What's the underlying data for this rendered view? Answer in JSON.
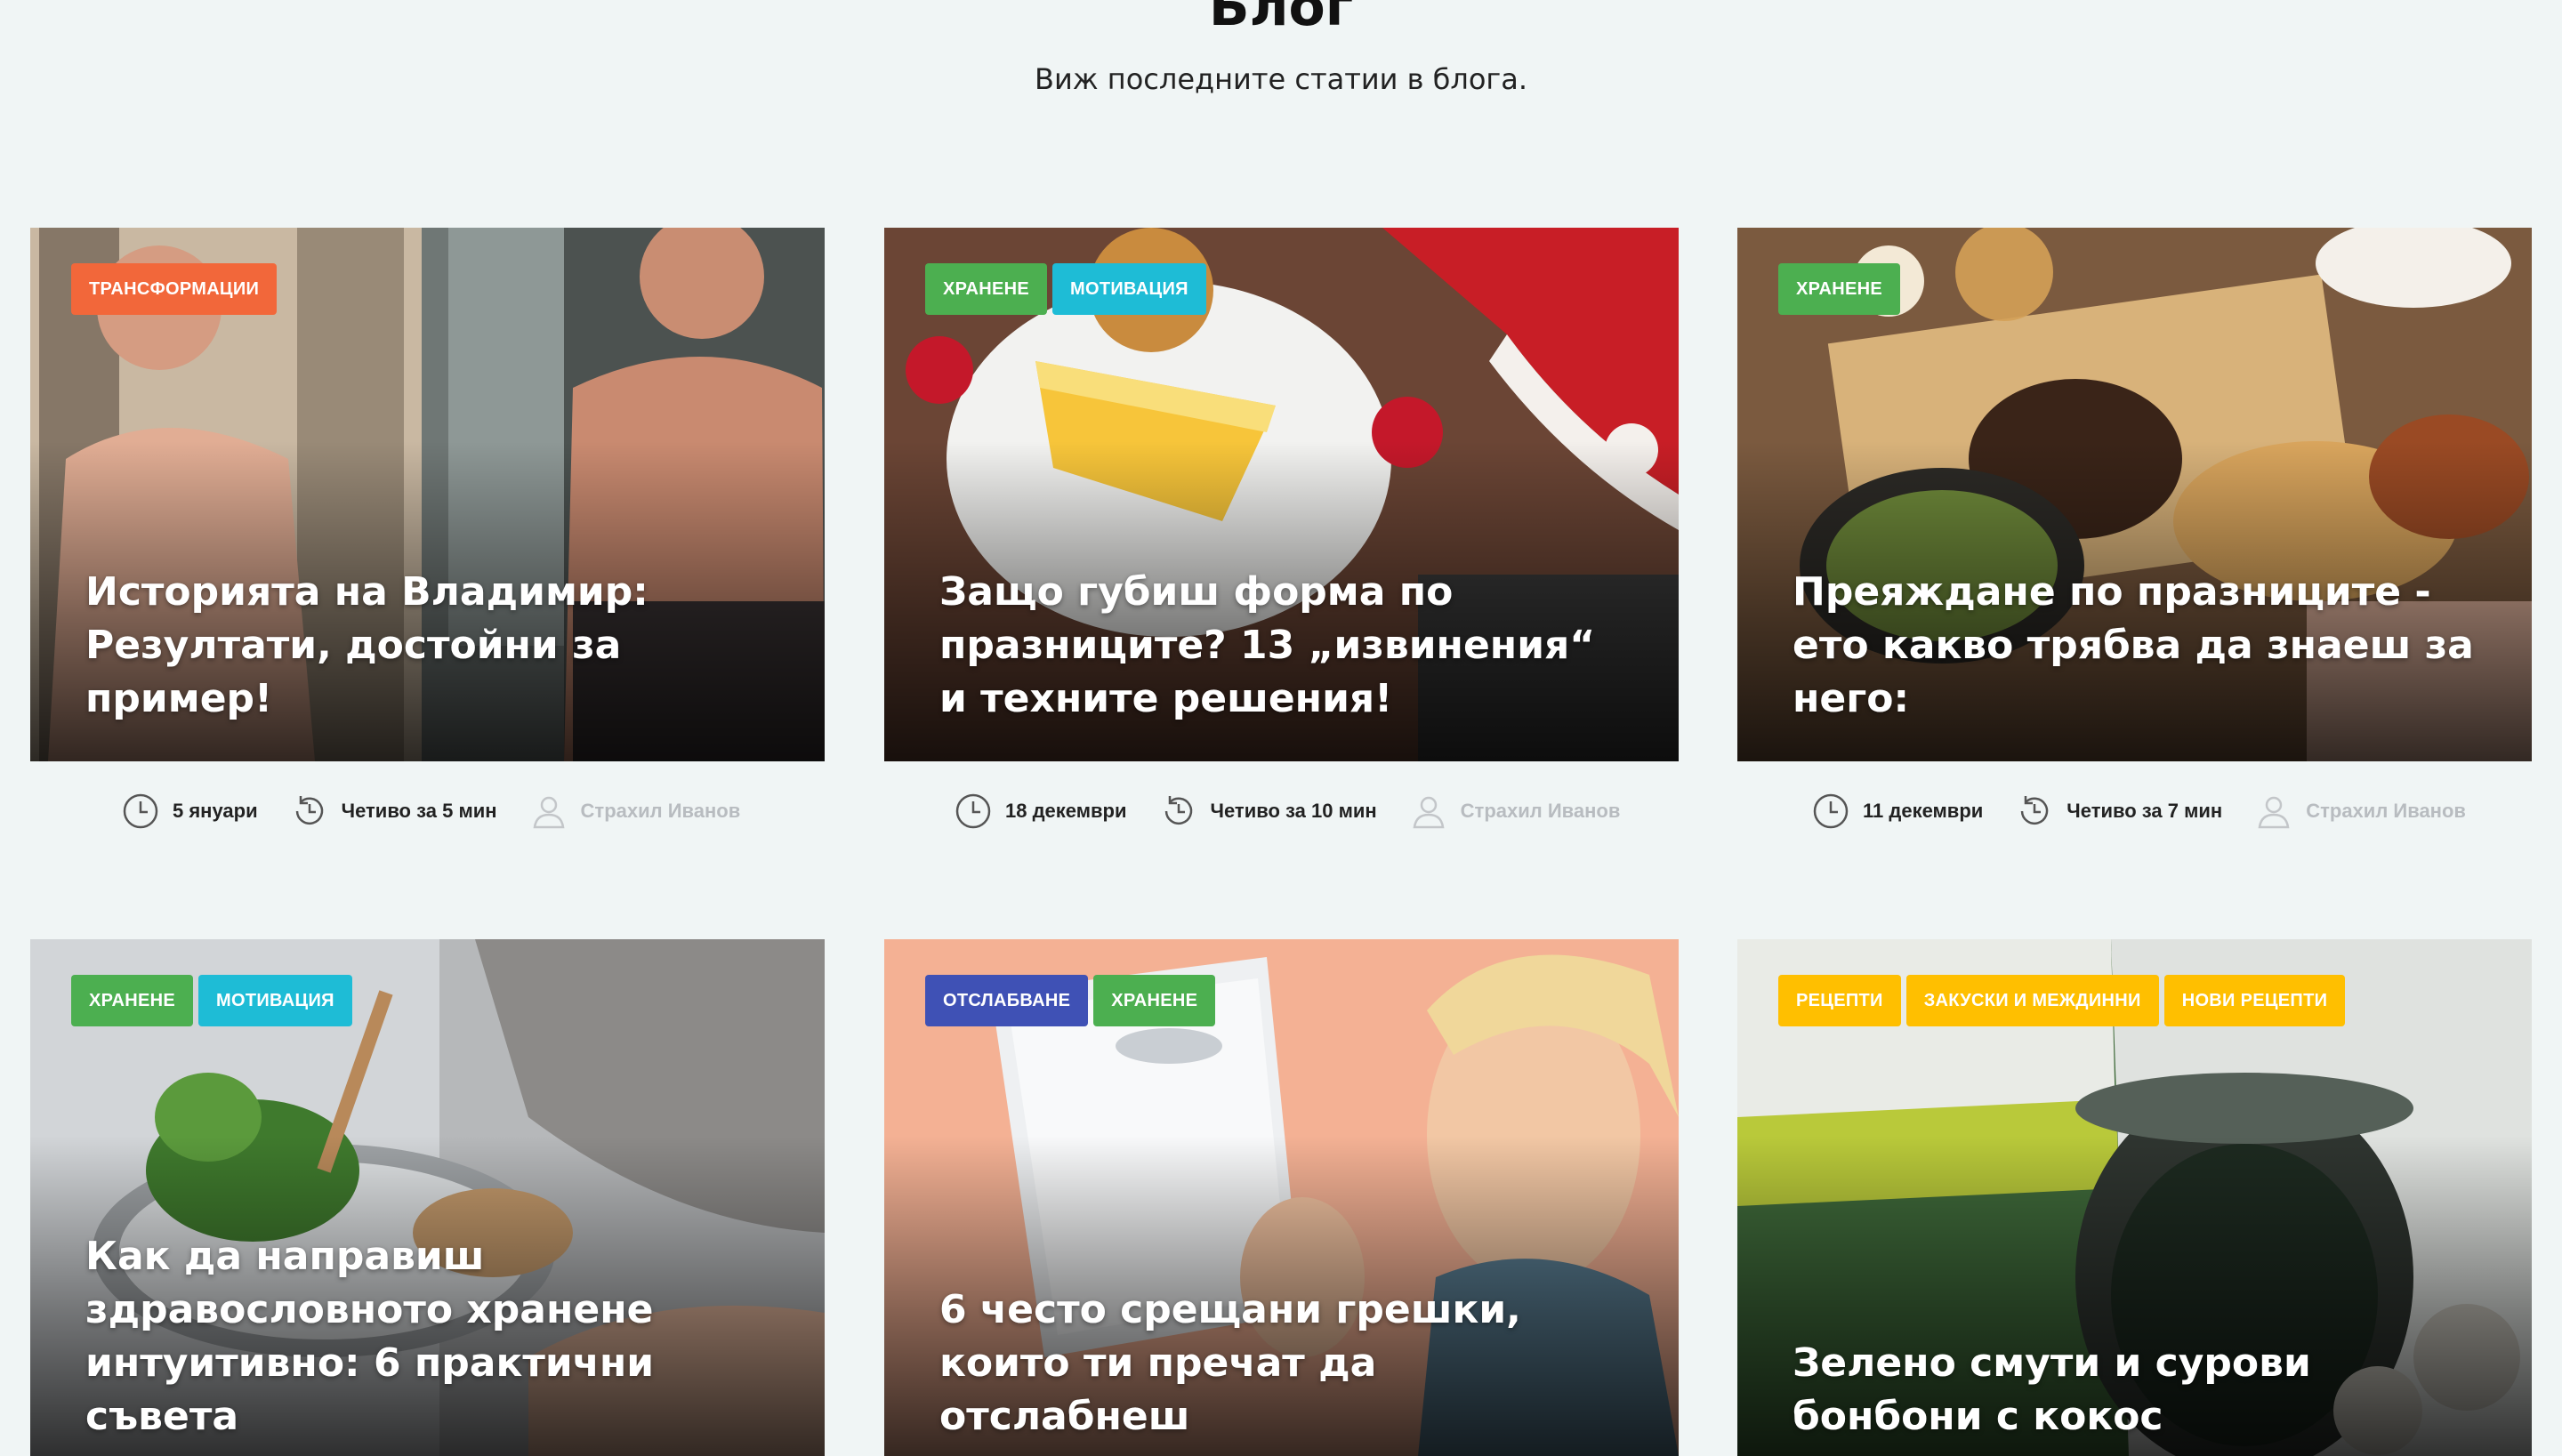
{
  "header": {
    "title": "Блог",
    "subtitle": "Виж последните статии в блога."
  },
  "colors": {
    "transformations": "#f2673a",
    "nutrition": "#4caf50",
    "motivation": "#1ebcd6",
    "weight_loss": "#3f51b5",
    "recipes": "#ffbf00"
  },
  "posts": [
    {
      "tags": [
        "ТРАНСФОРМАЦИИ"
      ],
      "title": "Историята на Владимир: Резултати, достойни за пример!",
      "date": "5 януари",
      "read_time": "Четиво за 5 мин",
      "author": "Страхил Иванов",
      "image": "before-after-man-photo"
    },
    {
      "tags": [
        "ХРАНЕНЕ",
        "МОТИВАЦИЯ"
      ],
      "title": "Защо губиш форма по празниците? 13 „извинения“ и техните решения!",
      "date": "18 декември",
      "read_time": "Четиво за 10 мин",
      "author": "Страхил Иванов",
      "image": "holiday-cake-photo"
    },
    {
      "tags": [
        "ХРАНЕНЕ"
      ],
      "title": "Преяждане по празниците - ето какво трябва да знаеш за него:",
      "date": "11 декември",
      "read_time": "Четиво за 7 мин",
      "author": "Страхил Иванов",
      "image": "holiday-table-photo"
    },
    {
      "tags": [
        "ХРАНЕНЕ",
        "МОТИВАЦИЯ"
      ],
      "title": "Как да направиш здравословното хранене интуитивно: 6 практични съвета",
      "image": "salad-plate-photo"
    },
    {
      "tags": [
        "ОТСЛАБВАНЕ",
        "ХРАНЕНЕ"
      ],
      "title": "6 често срещани грешки, които ти пречат да отслабнеш",
      "image": "scale-woman-photo"
    },
    {
      "tags": [
        "РЕЦЕПТИ",
        "ЗАКУСКИ И МЕЖДИННИ",
        "НОВИ РЕЦЕПТИ"
      ],
      "title": "Зелено смути и сурови бонбони с кокос",
      "image": "spirulina-smoothie-photo"
    }
  ]
}
